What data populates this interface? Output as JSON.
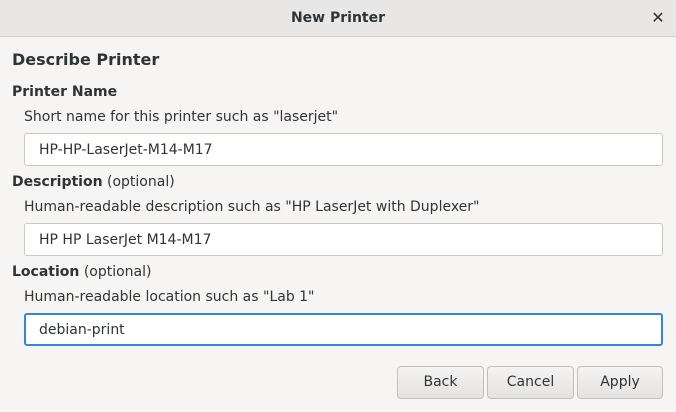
{
  "window": {
    "title": "New Printer",
    "close_glyph": "✕"
  },
  "section": {
    "heading": "Describe Printer"
  },
  "printer_name": {
    "label": "Printer Name",
    "hint": "Short name for this printer such as \"laserjet\"",
    "value": "HP-HP-LaserJet-M14-M17"
  },
  "description": {
    "label": "Description",
    "optional": " (optional)",
    "hint": "Human-readable description such as \"HP LaserJet with Duplexer\"",
    "value": "HP HP LaserJet M14-M17"
  },
  "location": {
    "label": "Location",
    "optional": " (optional)",
    "hint": "Human-readable location such as \"Lab 1\"",
    "value": "debian-print"
  },
  "buttons": {
    "back": "Back",
    "cancel": "Cancel",
    "apply": "Apply"
  },
  "colors": {
    "focus_accent": "#3584e4",
    "background": "#f6f5f4"
  }
}
